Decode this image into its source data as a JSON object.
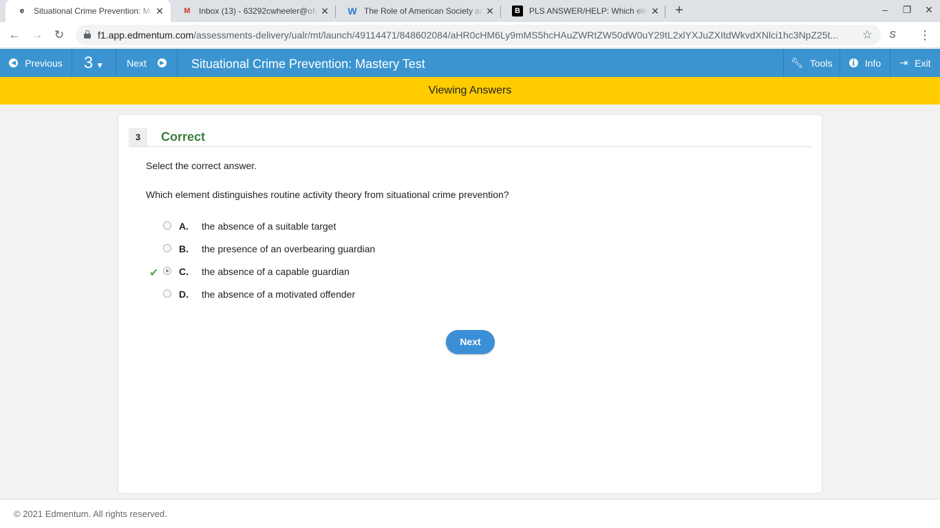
{
  "browser": {
    "tabs": [
      {
        "title": "Situational Crime Prevention: Ma",
        "icon": "edmentum-icon",
        "active": true
      },
      {
        "title": "Inbox (13) - 63292cwheeler@ofy",
        "icon": "gmail-icon",
        "active": false
      },
      {
        "title": "The Role of American Society an",
        "icon": "word-icon",
        "active": false
      },
      {
        "title": "PLS ANSWER/HELP: Which elem",
        "icon": "brainly-icon",
        "active": false
      }
    ],
    "new_tab": "+",
    "url_host": "f1.app.edmentum.com",
    "url_path": "/assessments-delivery/ualr/mt/launch/49114471/848602084/aHR0cHM6Ly9mMS5hcHAuZWRtZW50dW0uY29tL2xlYXJuZXItdWkvdXNlci1hc3NpZ25t..."
  },
  "header": {
    "previous_label": "Previous",
    "question_number": "3",
    "next_label": "Next",
    "title": "Situational Crime Prevention: Mastery Test",
    "tools_label": "Tools",
    "info_label": "Info",
    "exit_label": "Exit"
  },
  "banner": "Viewing Answers",
  "question": {
    "number": "3",
    "status": "Correct",
    "instruction": "Select the correct answer.",
    "text": "Which element distinguishes routine activity theory from situational crime prevention?",
    "choices": [
      {
        "letter": "A.",
        "text": "the absence of a suitable target",
        "selected": false,
        "correct": false
      },
      {
        "letter": "B.",
        "text": "the presence of an overbearing guardian",
        "selected": false,
        "correct": false
      },
      {
        "letter": "C.",
        "text": "the absence of a capable guardian",
        "selected": true,
        "correct": true
      },
      {
        "letter": "D.",
        "text": "the absence of a motivated offender",
        "selected": false,
        "correct": false
      }
    ],
    "next_button": "Next"
  },
  "footer": "© 2021 Edmentum. All rights reserved.",
  "colors": {
    "header_blue": "#3b94cf",
    "banner_yellow": "#ffcc00",
    "correct_green": "#3e7d3e",
    "button_blue": "#3b8fd6"
  }
}
